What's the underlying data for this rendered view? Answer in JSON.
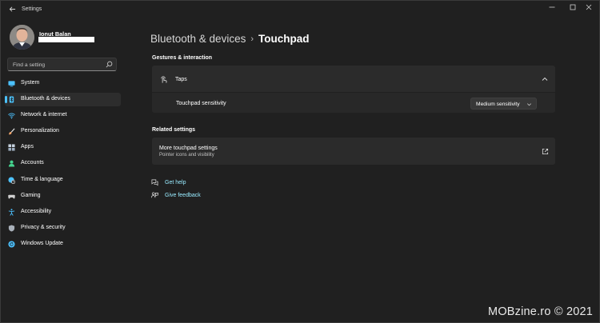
{
  "window": {
    "app_title": "Settings",
    "back_icon": "arrow-left-icon",
    "controls": [
      "minimize-icon",
      "maximize-icon",
      "close-icon"
    ]
  },
  "profile": {
    "name": "Ionut Balan"
  },
  "search": {
    "placeholder": "Find a setting"
  },
  "sidebar": {
    "items": [
      {
        "label": "System",
        "icon": "monitor-icon",
        "color": "#4cc2ff",
        "selected": false
      },
      {
        "label": "Bluetooth & devices",
        "icon": "bluetooth-icon",
        "color": "#4cc2ff",
        "selected": true
      },
      {
        "label": "Network & internet",
        "icon": "wifi-icon",
        "color": "#4cc2ff",
        "selected": false
      },
      {
        "label": "Personalization",
        "icon": "brush-icon",
        "color": "#f7a76c",
        "selected": false
      },
      {
        "label": "Apps",
        "icon": "apps-icon",
        "color": "#b9c7d6",
        "selected": false
      },
      {
        "label": "Accounts",
        "icon": "person-icon",
        "color": "#45d38f",
        "selected": false
      },
      {
        "label": "Time & language",
        "icon": "globe-clock-icon",
        "color": "#4cc2ff",
        "selected": false
      },
      {
        "label": "Gaming",
        "icon": "gamepad-icon",
        "color": "#c8c8c8",
        "selected": false
      },
      {
        "label": "Accessibility",
        "icon": "accessibility-icon",
        "color": "#4cc2ff",
        "selected": false
      },
      {
        "label": "Privacy & security",
        "icon": "shield-icon",
        "color": "#b4b4b4",
        "selected": false
      },
      {
        "label": "Windows Update",
        "icon": "update-icon",
        "color": "#4cc2ff",
        "selected": false
      }
    ]
  },
  "main": {
    "breadcrumb_parent": "Bluetooth & devices",
    "breadcrumb_separator": "›",
    "breadcrumb_current": "Touchpad",
    "gestures_heading": "Gestures & interaction",
    "taps_label": "Taps",
    "sensitivity_label": "Touchpad sensitivity",
    "sensitivity_value": "Medium sensitivity",
    "related_heading": "Related settings",
    "more_title": "More touchpad settings",
    "more_subtitle": "Pointer icons and visibility",
    "get_help": "Get help",
    "give_feedback": "Give feedback"
  },
  "watermark": "MOBzine.ro © 2021",
  "colors": {
    "accent": "#4cc2ff",
    "link": "#99ebff",
    "background": "#202020",
    "card": "#2b2b2b"
  }
}
